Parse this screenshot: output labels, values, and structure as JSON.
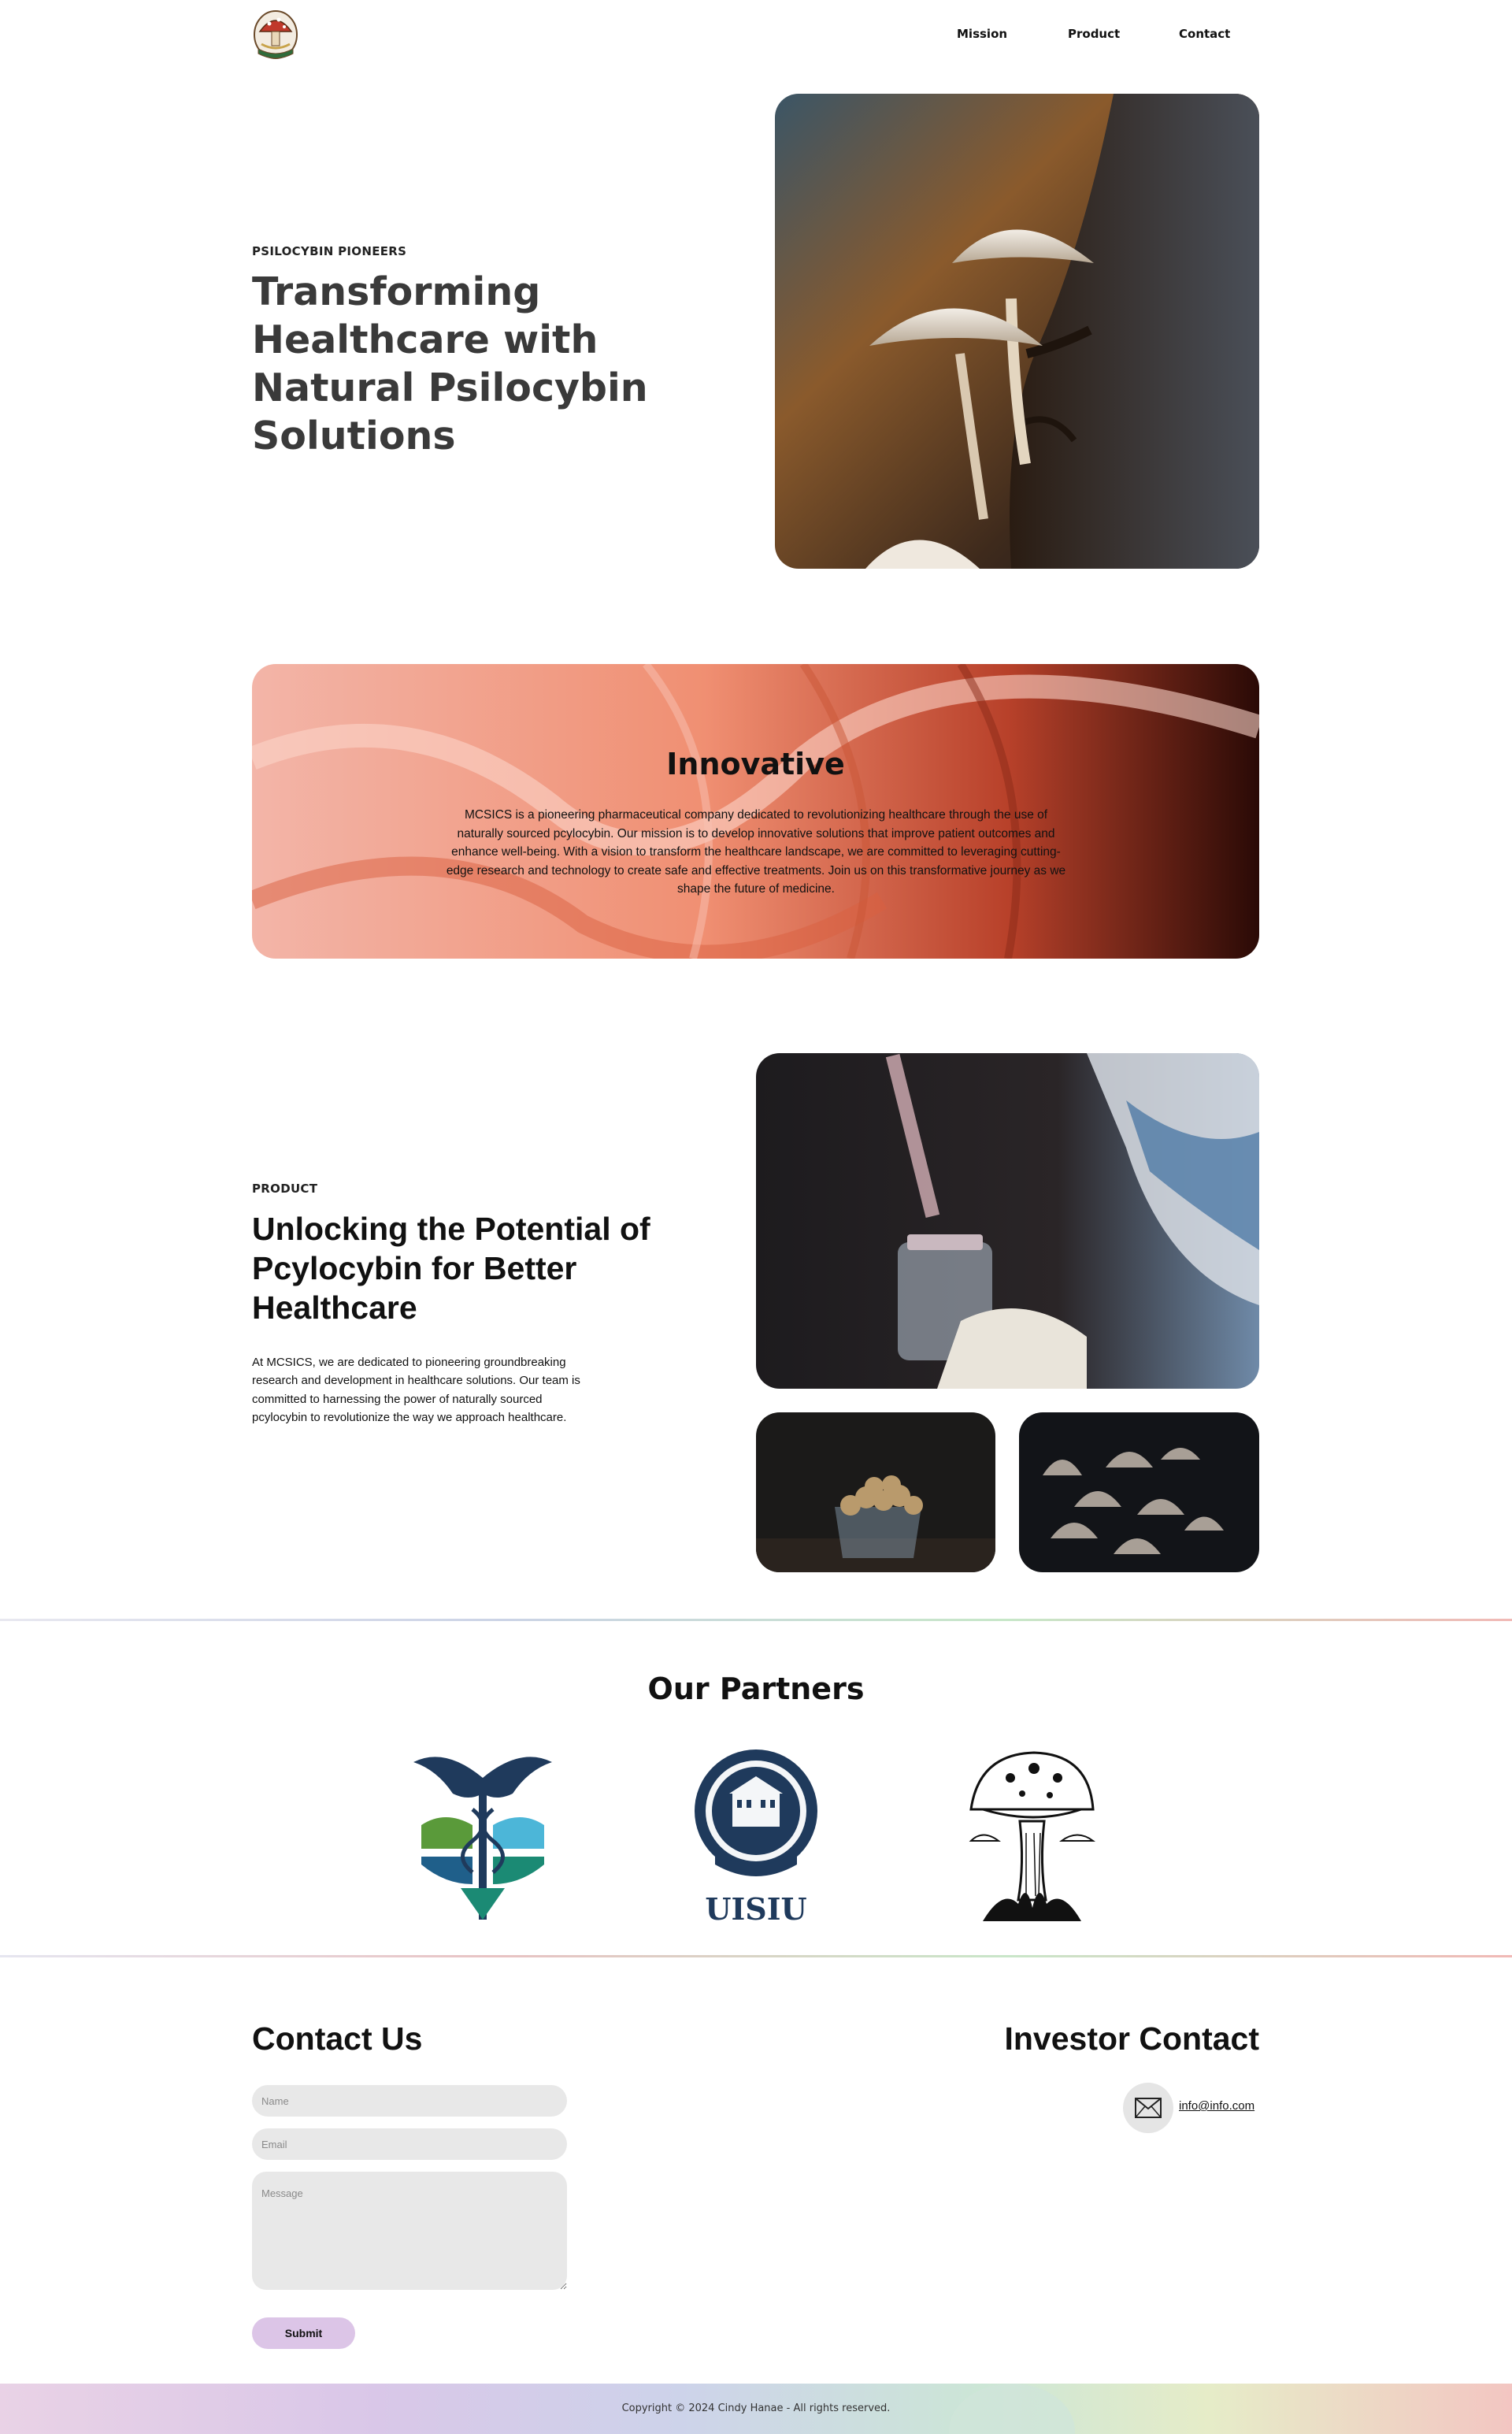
{
  "header": {
    "logo_alt": "MCSICS logo",
    "nav": [
      "Mission",
      "Product",
      "Contact"
    ]
  },
  "hero": {
    "eyebrow": "PSILOCYBIN PIONEERS",
    "title": "Transforming Healthcare with Natural Psilocybin Solutions"
  },
  "innovative": {
    "title": "Innovative",
    "text": "MCSICS is a pioneering pharmaceutical company dedicated to revolutionizing healthcare through the use of naturally sourced pcylocybin. Our mission is to develop innovative solutions that improve patient outcomes and enhance well-being. With a vision to transform the healthcare landscape, we are committed to leveraging cutting-edge research and technology to create safe and effective treatments. Join us on this transformative journey as we shape the future of medicine."
  },
  "product": {
    "eyebrow": "PRODUCT",
    "title": "Unlocking the Potential of Pcylocybin for Better Healthcare",
    "text": "At MCSICS, we are dedicated to pioneering groundbreaking research and development in healthcare solutions. Our team is committed to harnessing the power of naturally sourced pcylocybin to revolutionize the way we approach healthcare."
  },
  "partners": {
    "title": "Our Partners",
    "logos": [
      {
        "name": "caduceus-eagle-logo"
      },
      {
        "name": "uisiu-seal-logo",
        "wordmark": "UISIU"
      },
      {
        "name": "mushroom-illustration-logo"
      }
    ]
  },
  "contact": {
    "title": "Contact Us",
    "name_placeholder": "Name",
    "email_placeholder": "Email",
    "message_placeholder": "Message",
    "submit_label": "Submit"
  },
  "investor": {
    "title": "Investor Contact",
    "email": "info@info.com"
  },
  "footer": {
    "copyright": "Copyright © 2024 Cindy Hanae - All rights reserved."
  },
  "colors": {
    "submit_bg": "#dcc5e7",
    "field_bg": "#e8e8e8",
    "heading": "#111111",
    "hero_heading": "#3a3a3a"
  }
}
